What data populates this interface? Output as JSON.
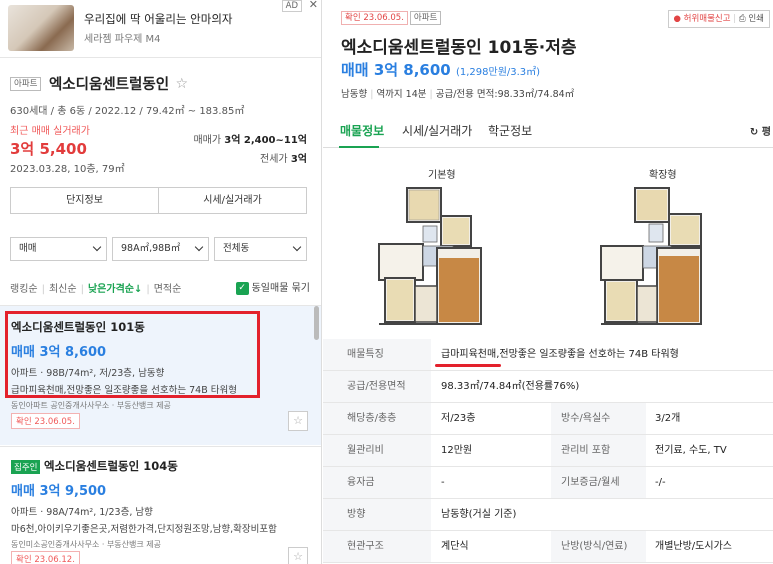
{
  "ad": {
    "title": "우리집에 딱 어울리는 안마의자",
    "subtitle": "세라젬 파우제 M4",
    "badge": "AD",
    "close": "✕"
  },
  "complex": {
    "tag": "아파트",
    "name": "엑소디움센트럴동인",
    "info": "630세대 / 총 6동 / 2022.12 / 79.42㎡ ~ 183.85㎡",
    "recent_label": "최근 매매 실거래가",
    "recent_price": "3억 5,400",
    "recent_date": "2023.03.28, 10층, 79㎡",
    "sale_label": "매매가",
    "sale_value": "3억 2,400~11억",
    "jeonse_label": "전세가",
    "jeonse_value": "3억",
    "btn_info": "단지정보",
    "btn_price": "시세/실거래가"
  },
  "filters": {
    "type": "매매",
    "area": "98A㎡,98B㎡",
    "dong": "전체동"
  },
  "sort": {
    "ranking": "랭킹순",
    "newest": "최신순",
    "low_price": "낮은가격순↓",
    "area": "면적순",
    "check_icon": "✓",
    "same_listing": "동일매물 묶기"
  },
  "listings": [
    {
      "title": "엑소디움센트럴동인 101동",
      "price": "매매 3억 8,600",
      "spec": "아파트 · 98B/74m², 저/23층, 남동향",
      "desc": "급마피육천매,전망좋은 일조량좋을 선호하는 74B 타워형",
      "agency": "동인아파트 공인중개사사무소 · 부동산뱅크 제공",
      "confirm": "확인 23.06.05."
    },
    {
      "tag": "집주인",
      "title": "엑소디움센트럴동인 104동",
      "price": "매매 3억 9,500",
      "spec": "아파트 · 98A/74m², 1/23층, 남향",
      "desc": "마6천,아이키우기좋은곳,저렴한가격,단지정원조망,남향,확장비포함",
      "agency": "동인미소공인중개사사무소 · 부동산뱅크 제공",
      "confirm": "확인 23.06.12."
    }
  ],
  "detail": {
    "confirm_tag": "확인 23.06.05.",
    "type_tag": "아파트",
    "report": "허위매물신고",
    "print": "인쇄",
    "title": "엑소디움센트럴동인 101동·저층",
    "price": "매매 3억 8,600",
    "price_unit": "(1,298만원/3.3㎡)",
    "direction": "남동향",
    "station": "역까지 14분",
    "area": "공급/전용 면적:98.33㎡/74.84㎡",
    "tabs": [
      "매물정보",
      "시세/실거래가",
      "학군정보"
    ],
    "tab_extra": "평",
    "floorplan_basic": "기본형",
    "floorplan_expanded": "확장형",
    "table": [
      {
        "k": "매물특징",
        "v": "급마피육천매,전망좋은 일조량좋을 선호하는 74B 타워형"
      },
      {
        "k": "공급/전용면적",
        "v": "98.33㎡/74.84㎡(전용률76%)"
      },
      {
        "k": "해당층/총층",
        "v": "저/23층",
        "k2": "방수/욕실수",
        "v2": "3/2개"
      },
      {
        "k": "월관리비",
        "v": "12만원",
        "k2": "관리비 포함",
        "v2": "전기료, 수도, TV"
      },
      {
        "k": "융자금",
        "v": "-",
        "k2": "기보증금/월세",
        "v2": "-/-"
      },
      {
        "k": "방향",
        "v": "남동향(거실 기준)"
      },
      {
        "k": "현관구조",
        "v": "계단식",
        "k2": "난방(방식/연료)",
        "v2": "개별난방/도시가스"
      }
    ]
  },
  "colors": {
    "accent_green": "#1aa352",
    "price_blue": "#2a7fe0",
    "alert_red": "#e3212c"
  }
}
